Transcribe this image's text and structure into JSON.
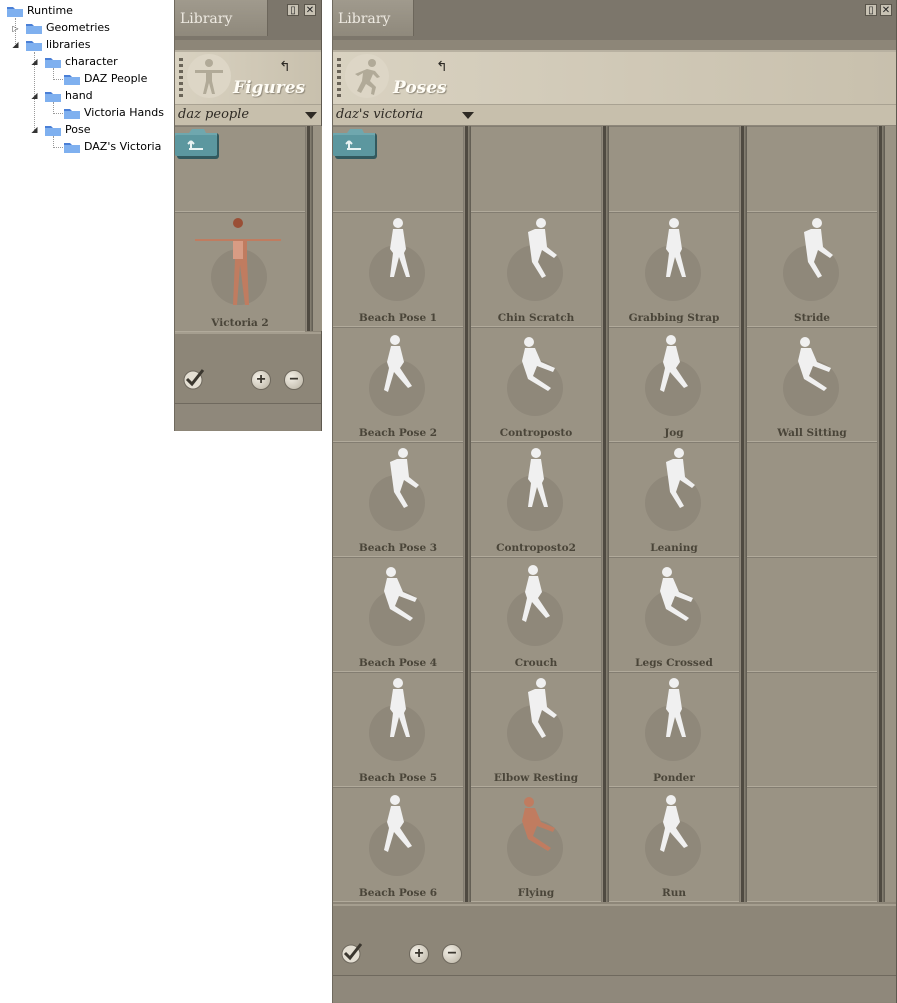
{
  "tree": {
    "root": "Runtime",
    "geometries": "Geometries",
    "libraries": "libraries",
    "character": "character",
    "daz_people": "DAZ People",
    "hand": "hand",
    "victoria_hands": "Victoria Hands",
    "pose": "Pose",
    "dazs_victoria": "DAZ's Victoria",
    "toggle_collapsed": "▷",
    "toggle_expanded": "◢"
  },
  "figures_panel": {
    "title": "Library",
    "category": "Figures",
    "dropdown_value": "daz people",
    "items": [
      {
        "label": "Victoria 2",
        "skin": "#c58a72"
      }
    ]
  },
  "poses_panel": {
    "title": "Library",
    "category": "Poses",
    "dropdown_value": "daz's victoria",
    "columns": [
      [
        "Beach Pose 1",
        "Beach Pose 2",
        "Beach Pose 3",
        "Beach Pose 4",
        "Beach Pose 5",
        "Beach Pose 6"
      ],
      [
        "Chin Scratch",
        "Controposto",
        "Controposto2",
        "Crouch",
        "Elbow Resting",
        "Flying"
      ],
      [
        "Grabbing Strap",
        "Jog",
        "Leaning",
        "Legs Crossed",
        "Ponder",
        "Run"
      ],
      [
        "Stride",
        "Wall Sitting"
      ]
    ]
  },
  "window_buttons": {
    "dock": "▯",
    "close": "✕"
  },
  "footer": {
    "add": "+",
    "remove": "−"
  },
  "colors": {
    "panel_bg": "#8d8678",
    "grid_bg": "#9a9384",
    "banner_bg": "#d9d2c1",
    "label_text": "#4a4539",
    "folder_teal": "#4f8d95",
    "figure_white": "#f0f0f0",
    "figure_skin": "#c07c60"
  },
  "icons": [
    "folder-icon",
    "figure-icon",
    "run-icon",
    "up-folder-icon",
    "checkmark-icon",
    "plus-icon",
    "minus-icon",
    "return-arrow-icon",
    "caret-down-icon"
  ]
}
